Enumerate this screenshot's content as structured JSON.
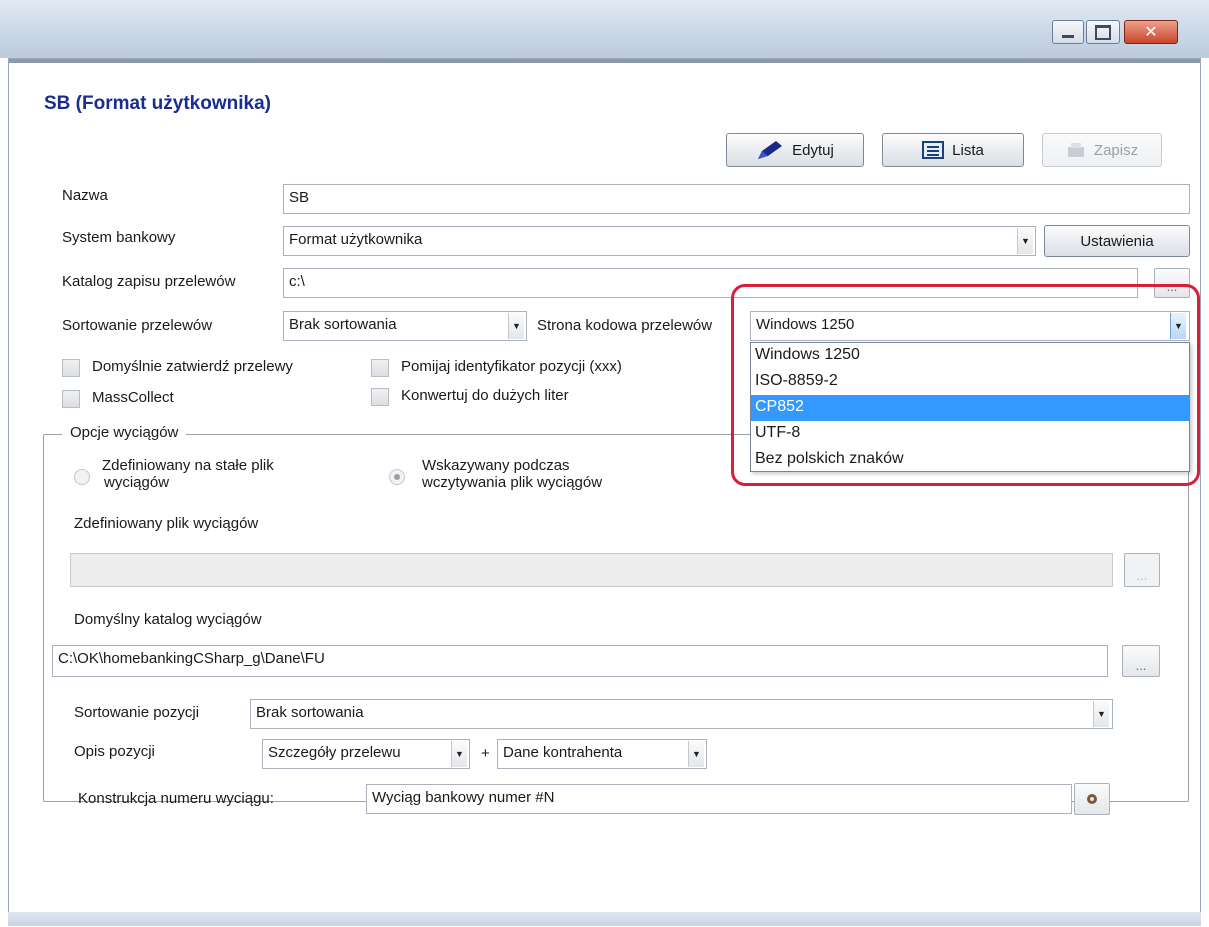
{
  "window": {
    "min_label": "",
    "max_label": "",
    "close_label": "✕"
  },
  "page_title": "SB (Format użytkownika)",
  "toolbar": {
    "edit_label": "Edytuj",
    "list_label": "Lista",
    "save_label": "Zapisz"
  },
  "form": {
    "name_label": "Nazwa",
    "name_value": "SB",
    "bank_system_label": "System bankowy",
    "bank_system_value": "Format użytkownika",
    "settings_label": "Ustawienia",
    "transfer_dir_label": "Katalog zapisu przelewów",
    "transfer_dir_value": "c:\\",
    "browse_label": "...",
    "sort_transfers_label": "Sortowanie przelewów",
    "sort_transfers_value": "Brak sortowania",
    "codepage_label": "Strona kodowa przelewów",
    "codepage_value": "Windows 1250",
    "codepage_options": [
      "Windows 1250",
      "ISO-8859-2",
      "CP852",
      "UTF-8",
      "Bez polskich znaków"
    ],
    "codepage_selected_index": 2,
    "chk_auto_approve": "Domyślnie zatwierdź przelewy",
    "chk_skip_id": "Pomijaj identyfikator pozycji (xxx)",
    "chk_masscollect": "MassCollect",
    "chk_uppercase": "Konwertuj do dużych liter"
  },
  "statements": {
    "group_label": "Opcje wyciągów",
    "radio_fixed": "Zdefiniowany na stałe plik wyciągów",
    "radio_fixed_line1": "Zdefiniowany na stałe plik",
    "radio_fixed_line2": "wyciągów",
    "radio_prompt_line1": "Wskazywany podczas",
    "radio_prompt_line2": "wczytywania plik wyciągów",
    "defined_file_label": "Zdefiniowany plik wyciągów",
    "defined_file_value": "",
    "default_dir_label": "Domyślny katalog wyciągów",
    "default_dir_value": "C:\\OK\\homebankingCSharp_g\\Dane\\FU",
    "sort_items_label": "Sortowanie pozycji",
    "sort_items_value": "Brak sortowania",
    "item_desc_label": "Opis pozycji",
    "item_desc_value1": "Szczegóły przelewu",
    "plus": "+",
    "item_desc_value2": "Dane kontrahenta",
    "number_label": "Konstrukcja numeru wyciągu:",
    "number_value": "Wyciąg bankowy numer #N"
  },
  "icons": {
    "edit": "pencil-icon",
    "list": "list-icon",
    "save": "save-icon",
    "number": "settings-icon"
  },
  "colors": {
    "title": "#1a2d8f",
    "selection": "#3399ff",
    "highlight_ring": "#d81f3a"
  }
}
